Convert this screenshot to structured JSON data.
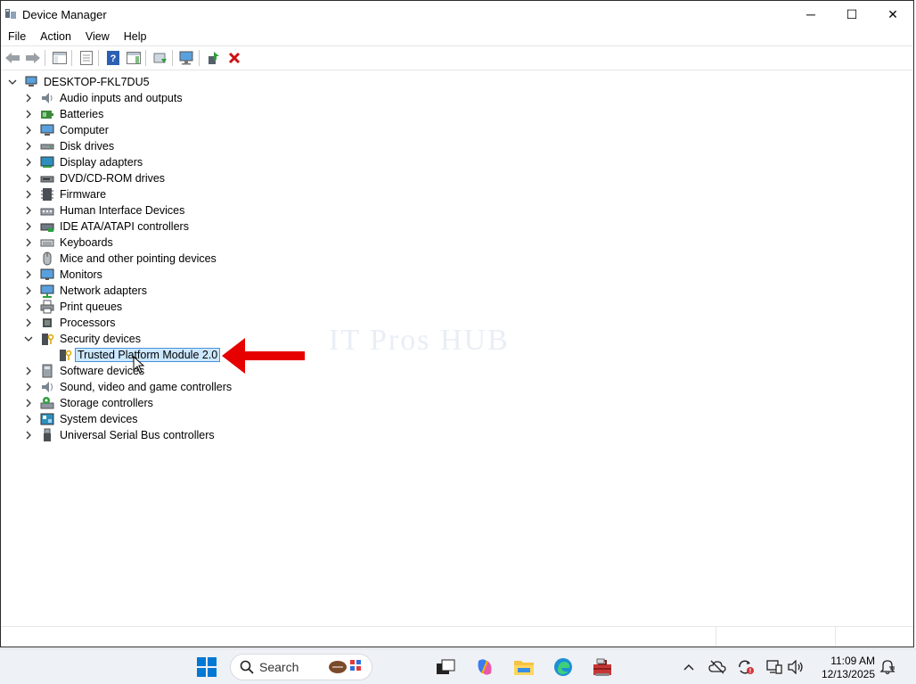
{
  "window": {
    "title": "Device Manager",
    "controls": {
      "minimize": "─",
      "maximize": "☐",
      "close": "✕"
    }
  },
  "menu": [
    "File",
    "Action",
    "View",
    "Help"
  ],
  "tree": {
    "root": "DESKTOP-FKL7DU5",
    "items": [
      {
        "label": "Audio inputs and outputs",
        "icon": "speaker-icon"
      },
      {
        "label": "Batteries",
        "icon": "battery-icon"
      },
      {
        "label": "Computer",
        "icon": "computer-icon"
      },
      {
        "label": "Disk drives",
        "icon": "disk-icon"
      },
      {
        "label": "Display adapters",
        "icon": "display-adapter-icon"
      },
      {
        "label": "DVD/CD-ROM drives",
        "icon": "dvd-icon"
      },
      {
        "label": "Firmware",
        "icon": "firmware-icon"
      },
      {
        "label": "Human Interface Devices",
        "icon": "hid-icon"
      },
      {
        "label": "IDE ATA/ATAPI controllers",
        "icon": "ide-icon"
      },
      {
        "label": "Keyboards",
        "icon": "keyboard-icon"
      },
      {
        "label": "Mice and other pointing devices",
        "icon": "mouse-icon"
      },
      {
        "label": "Monitors",
        "icon": "monitor-icon"
      },
      {
        "label": "Network adapters",
        "icon": "network-icon"
      },
      {
        "label": "Print queues",
        "icon": "printer-icon"
      },
      {
        "label": "Processors",
        "icon": "processor-icon"
      },
      {
        "label": "Security devices",
        "icon": "security-icon",
        "expanded": true
      },
      {
        "label": "Trusted Platform Module 2.0",
        "icon": "tpm-icon",
        "child": true,
        "selected": true
      },
      {
        "label": "Software devices",
        "icon": "software-icon"
      },
      {
        "label": "Sound, video and game controllers",
        "icon": "sound-icon"
      },
      {
        "label": "Storage controllers",
        "icon": "storage-icon"
      },
      {
        "label": "System devices",
        "icon": "system-icon"
      },
      {
        "label": "Universal Serial Bus controllers",
        "icon": "usb-icon"
      }
    ]
  },
  "watermark": "IT Pros HUB",
  "taskbar": {
    "search_placeholder": "Search",
    "time": "11:09 AM",
    "date": "12/13/2025"
  },
  "colors": {
    "accent": "#0078d4",
    "arrow": "#e60000",
    "selection": "#cce8ff"
  }
}
